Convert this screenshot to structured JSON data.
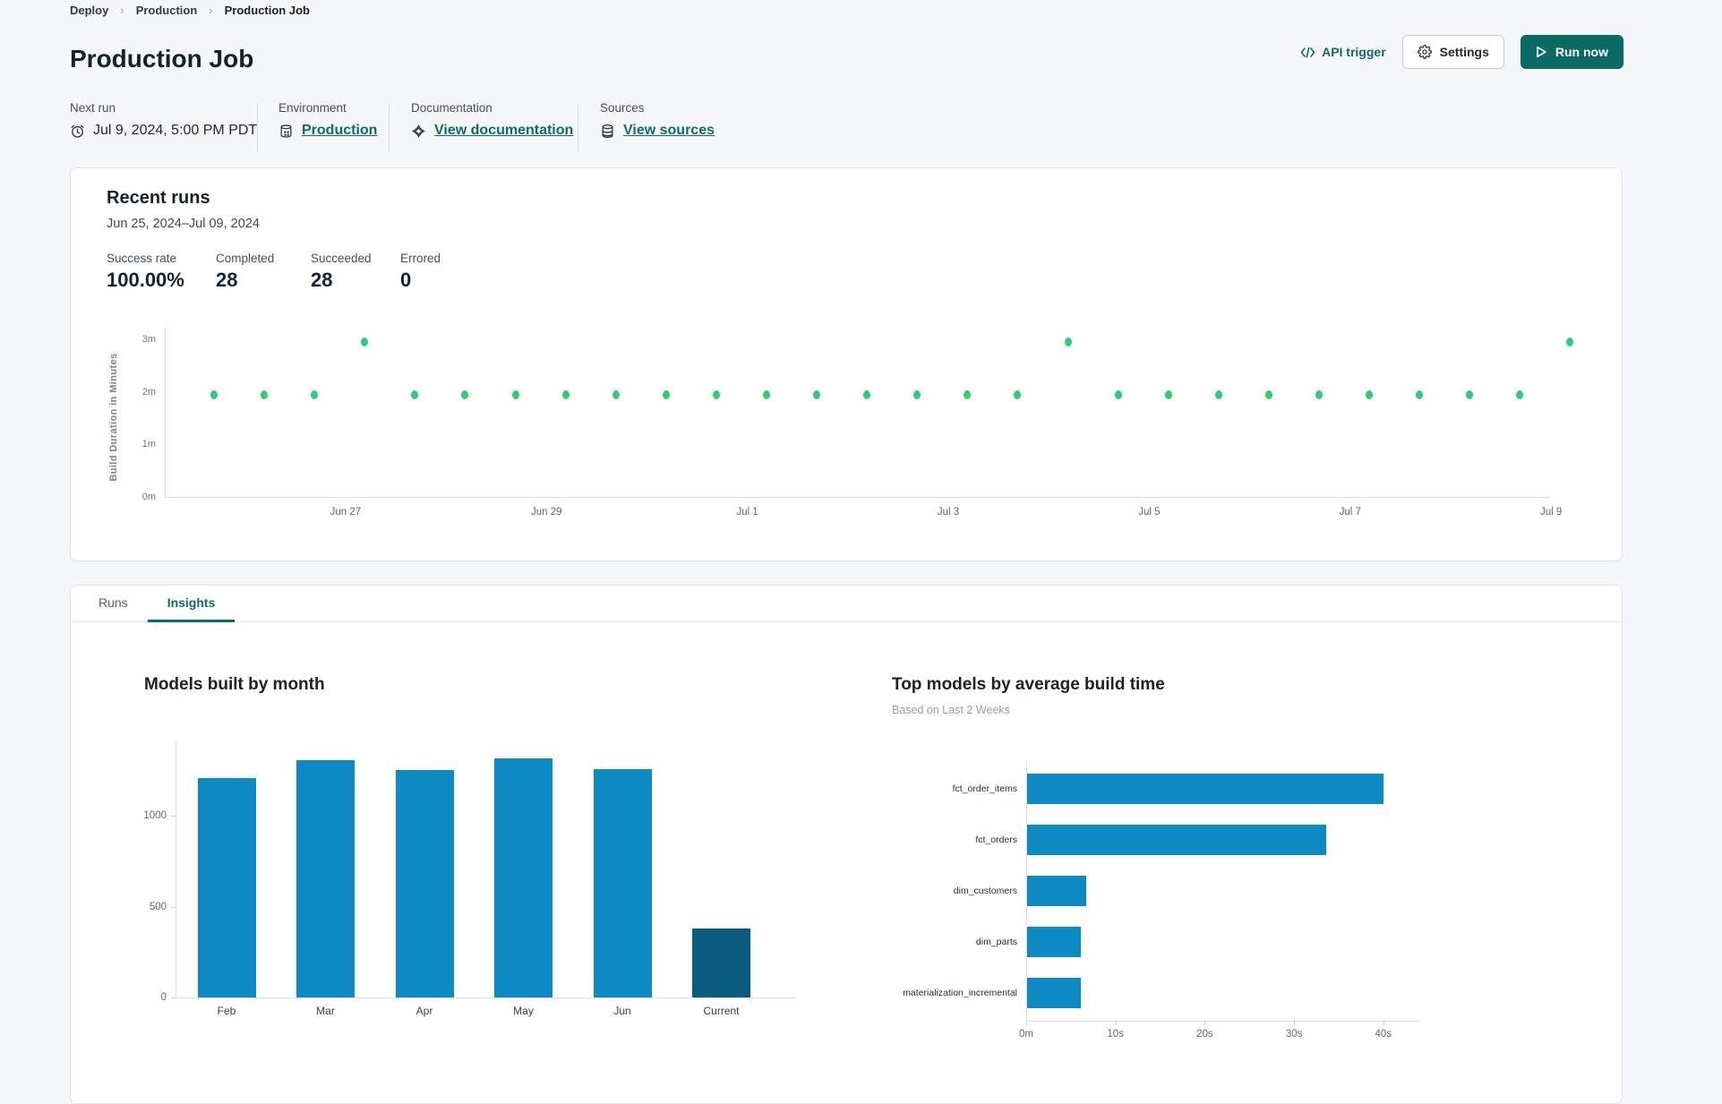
{
  "breadcrumb": {
    "items": [
      "Deploy",
      "Production",
      "Production Job"
    ],
    "separator": "›"
  },
  "header": {
    "title": "Production Job",
    "api_trigger_label": "API trigger",
    "settings_label": "Settings",
    "run_now_label": "Run now"
  },
  "meta": {
    "sections": [
      {
        "label": "Next run",
        "value": "Jul 9, 2024, 5:00 PM PDT",
        "icon": "clock-icon",
        "link": false
      },
      {
        "label": "Environment",
        "value": "Production",
        "icon": "environment-icon",
        "link": true
      },
      {
        "label": "Documentation",
        "value": "View documentation",
        "icon": "dbt-icon",
        "link": true
      },
      {
        "label": "Sources",
        "value": "View sources",
        "icon": "database-icon",
        "link": true
      }
    ]
  },
  "recent_runs": {
    "title": "Recent runs",
    "date_range": "Jun 25, 2024–Jul 09, 2024",
    "stats": [
      {
        "label": "Success rate",
        "value": "100.00%"
      },
      {
        "label": "Completed",
        "value": "28"
      },
      {
        "label": "Succeeded",
        "value": "28"
      },
      {
        "label": "Errored",
        "value": "0"
      }
    ]
  },
  "tabs": [
    {
      "label": "Runs",
      "active": false
    },
    {
      "label": "Insights",
      "active": true
    }
  ],
  "colors": {
    "accent_teal": "#0c6d68",
    "button_teal": "#0a6a64",
    "bar_blue": "#0d89c4",
    "bar_dark_blue": "#095c7d",
    "dot_green": "#2ecd71"
  },
  "chart_data": [
    {
      "id": "build-duration-scatter",
      "type": "scatter",
      "title": "Recent runs",
      "ylabel": "Build Duration in Minutes",
      "y_ticks": [
        {
          "label": "0m",
          "value": 0
        },
        {
          "label": "1m",
          "value": 1
        },
        {
          "label": "2m",
          "value": 2
        },
        {
          "label": "3m",
          "value": 3
        }
      ],
      "ylim": [
        0,
        3.4
      ],
      "x_domain_days": [
        0.2,
        13.99
      ],
      "x_ticks": [
        {
          "label": "Jun 27",
          "day": 2
        },
        {
          "label": "Jun 29",
          "day": 4
        },
        {
          "label": "Jul 1",
          "day": 6
        },
        {
          "label": "Jul 3",
          "day": 8
        },
        {
          "label": "Jul 5",
          "day": 10
        },
        {
          "label": "Jul 7",
          "day": 12
        },
        {
          "label": "Jul 9",
          "day": 14
        }
      ],
      "grid": false,
      "point_color": "#2ecd71",
      "points": [
        {
          "day": 0.69,
          "minutes": 1.95
        },
        {
          "day": 1.19,
          "minutes": 1.95
        },
        {
          "day": 1.69,
          "minutes": 1.95
        },
        {
          "day": 2.19,
          "minutes": 2.95
        },
        {
          "day": 2.69,
          "minutes": 1.95
        },
        {
          "day": 3.19,
          "minutes": 1.95
        },
        {
          "day": 3.69,
          "minutes": 1.95
        },
        {
          "day": 4.19,
          "minutes": 1.95
        },
        {
          "day": 4.69,
          "minutes": 1.95
        },
        {
          "day": 5.19,
          "minutes": 1.95
        },
        {
          "day": 5.69,
          "minutes": 1.95
        },
        {
          "day": 6.19,
          "minutes": 1.95
        },
        {
          "day": 6.69,
          "minutes": 1.95
        },
        {
          "day": 7.19,
          "minutes": 1.95
        },
        {
          "day": 7.69,
          "minutes": 1.95
        },
        {
          "day": 8.19,
          "minutes": 1.95
        },
        {
          "day": 8.69,
          "minutes": 1.95
        },
        {
          "day": 9.19,
          "minutes": 2.95
        },
        {
          "day": 9.69,
          "minutes": 1.95
        },
        {
          "day": 10.19,
          "minutes": 1.95
        },
        {
          "day": 10.69,
          "minutes": 1.95
        },
        {
          "day": 11.19,
          "minutes": 1.95
        },
        {
          "day": 11.69,
          "minutes": 1.95
        },
        {
          "day": 12.19,
          "minutes": 1.95
        },
        {
          "day": 12.69,
          "minutes": 1.95
        },
        {
          "day": 13.19,
          "minutes": 1.95
        },
        {
          "day": 13.69,
          "minutes": 1.95
        },
        {
          "day": 14.19,
          "minutes": 2.95
        }
      ]
    },
    {
      "id": "models-built-by-month",
      "type": "bar",
      "title": "Models built by month",
      "categories": [
        "Feb",
        "Mar",
        "Apr",
        "May",
        "Jun",
        "Current"
      ],
      "values": [
        1205,
        1305,
        1250,
        1315,
        1255,
        380
      ],
      "y_ticks": [
        0,
        500,
        1000
      ],
      "ylim": [
        0,
        1400
      ],
      "grid": false,
      "bar_colors": [
        "#0d89c4",
        "#0d89c4",
        "#0d89c4",
        "#0d89c4",
        "#0d89c4",
        "#095c7d"
      ]
    },
    {
      "id": "top-models-by-build-time",
      "type": "bar-horizontal",
      "title": "Top models by average build time",
      "subtitle": "Based on Last 2 Weeks",
      "categories": [
        "fct_order_items",
        "fct_orders",
        "dim_customers",
        "dim_parts",
        "materialization_incremental"
      ],
      "values_seconds": [
        39.9,
        33.5,
        6.6,
        6.0,
        6.0
      ],
      "x_ticks": [
        {
          "label": "0m",
          "value": 0
        },
        {
          "label": "10s",
          "value": 10
        },
        {
          "label": "20s",
          "value": 20
        },
        {
          "label": "30s",
          "value": 30
        },
        {
          "label": "40s",
          "value": 40
        }
      ],
      "xlim": [
        0,
        44
      ],
      "grid": false,
      "bar_color": "#0d89c4"
    }
  ]
}
